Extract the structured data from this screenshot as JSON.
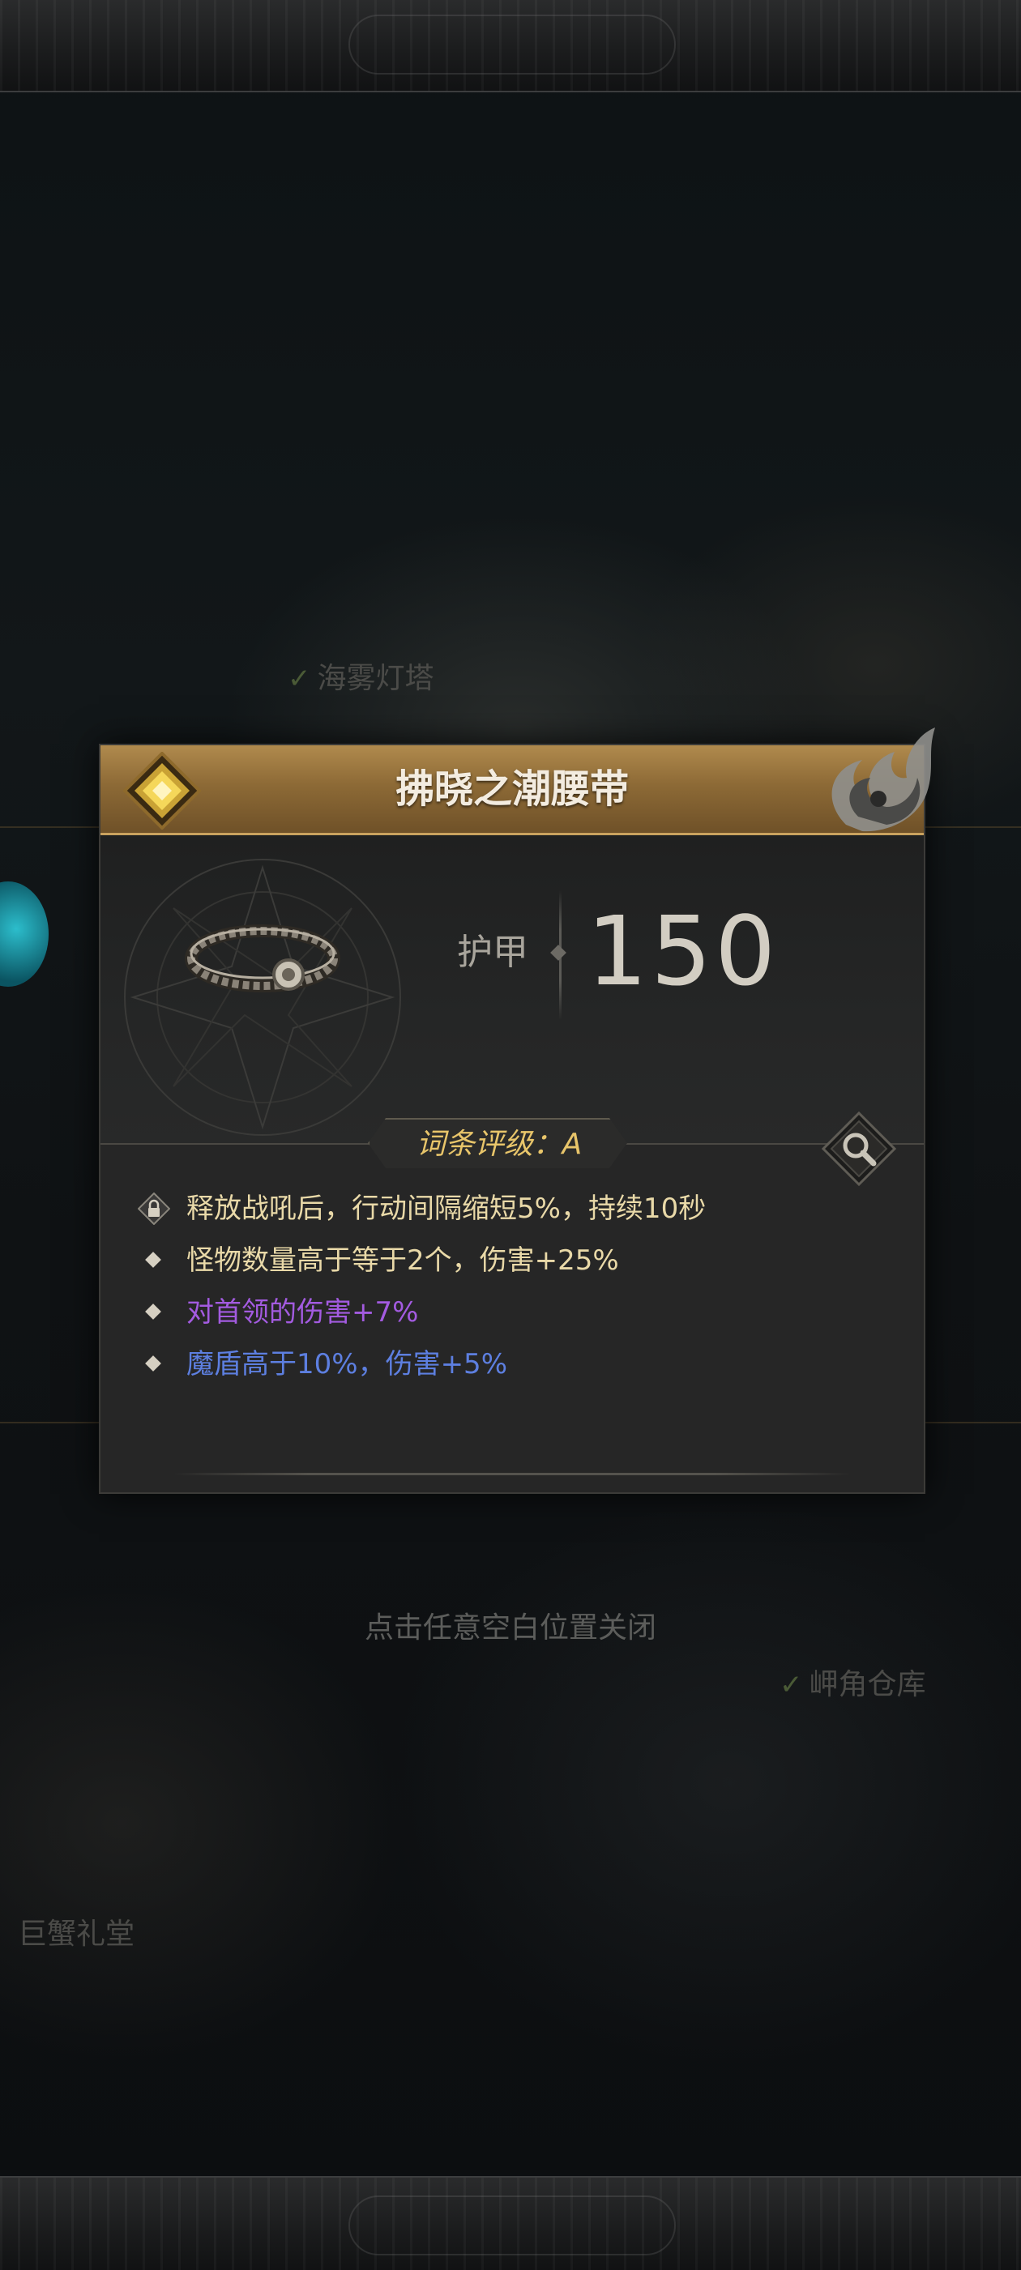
{
  "background": {
    "map_labels": [
      {
        "text": "海雾灯塔",
        "checked": true
      },
      {
        "text": "岬角仓库",
        "checked": true
      },
      {
        "text": "巨蟹礼堂",
        "checked": false
      }
    ],
    "close_hint": "点击任意空白位置关闭"
  },
  "item": {
    "name": "拂晓之潮腰带",
    "rarity_icon": "gold-diamond-rarity-icon",
    "emblem_icon": "flame-wing-emblem-icon",
    "image_icon": "belt-item-icon",
    "stat": {
      "label": "护甲",
      "value": "150"
    },
    "grade_text": "词条评级：A",
    "affixes": [
      {
        "text": "释放战吼后，行动间隔缩短5%，持续10秒",
        "color": "#e9d9a8",
        "locked": true
      },
      {
        "text": "怪物数量高于等于2个，伤害+25%",
        "color": "#e9d9a8",
        "locked": false
      },
      {
        "text": "对首领的伤害+7%",
        "color": "#a35be0",
        "locked": false
      },
      {
        "text": "魔盾高于10%，伤害+5%",
        "color": "#5d7fe0",
        "locked": false
      }
    ]
  },
  "colors": {
    "header_gold": "#b08a4d",
    "grade_text": "#e8c56a",
    "stat_value": "#d2cdc2"
  }
}
